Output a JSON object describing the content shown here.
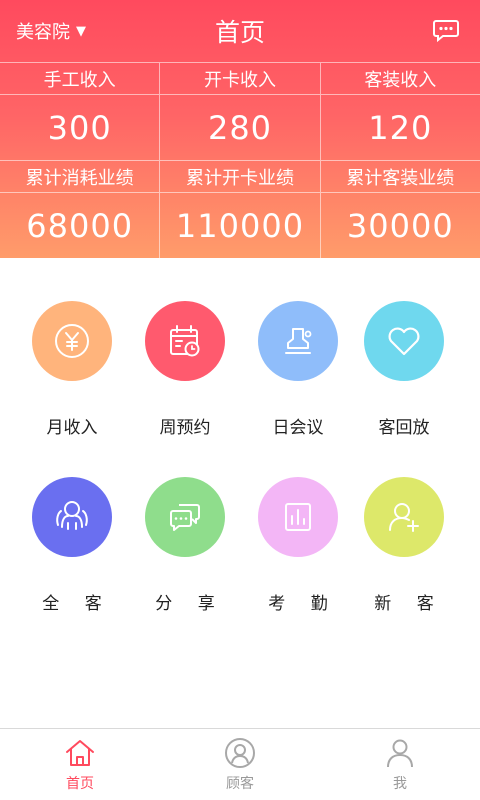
{
  "header": {
    "store": "美容院",
    "title": "首页"
  },
  "stats": {
    "row1_labels": [
      "手工收入",
      "开卡收入",
      "客装收入"
    ],
    "row1_values": [
      "300",
      "280",
      "120"
    ],
    "row2_labels": [
      "累计消耗业绩",
      "累计开卡业绩",
      "累计客装业绩"
    ],
    "row2_values": [
      "68000",
      "110000",
      "30000"
    ]
  },
  "features": [
    {
      "label": "月收入",
      "icon": "yuan-coin-icon",
      "color": "#ffb47c"
    },
    {
      "label": "周预约",
      "icon": "calendar-clock-icon",
      "color": "#ff5a6e"
    },
    {
      "label": "日会议",
      "icon": "meeting-stamp-icon",
      "color": "#8fbdfa"
    },
    {
      "label": "客回放",
      "icon": "heart-icon",
      "color": "#6fd8ee"
    },
    {
      "label": "全 客",
      "icon": "all-customers-icon",
      "color": "#6a6ff0"
    },
    {
      "label": "分 享",
      "icon": "chat-bubbles-icon",
      "color": "#8fdd8c"
    },
    {
      "label": "考 勤",
      "icon": "attendance-chart-icon",
      "color": "#f3b6f6"
    },
    {
      "label": "新 客",
      "icon": "add-user-icon",
      "color": "#dde86a"
    }
  ],
  "nav": [
    {
      "label": "首页",
      "icon": "home-icon",
      "active": true
    },
    {
      "label": "顾客",
      "icon": "customer-icon",
      "active": false
    },
    {
      "label": "我",
      "icon": "profile-icon",
      "active": false
    }
  ],
  "colors": {
    "accent": "#ff4a5e",
    "gradient_end": "#ff9c6a",
    "inactive_tab": "#999999"
  }
}
